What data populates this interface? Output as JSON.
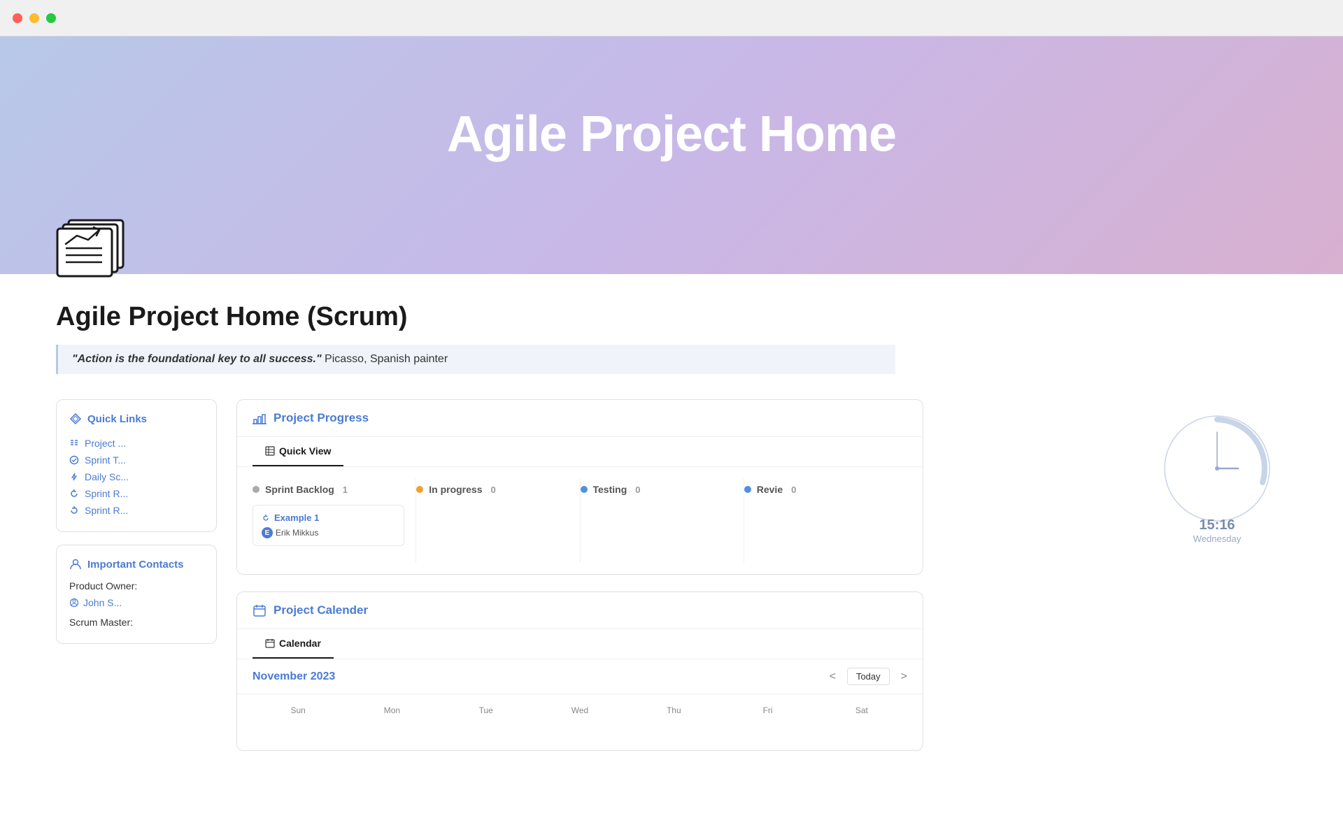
{
  "window": {
    "traffic_lights": [
      "red",
      "yellow",
      "green"
    ]
  },
  "hero": {
    "title": "Agile Project Home",
    "gradient_start": "#b8c4e0",
    "gradient_end": "#d4a8d8"
  },
  "page": {
    "title": "Agile Project Home (Scrum)",
    "quote_italic": "\"Action is the foundational key to all success.\"",
    "quote_attribution": " Picasso, Spanish painter"
  },
  "quick_links": {
    "title": "Quick Links",
    "items": [
      {
        "icon": "list-icon",
        "label": "Project ..."
      },
      {
        "icon": "check-icon",
        "label": "Sprint T..."
      },
      {
        "icon": "lightning-icon",
        "label": "Daily Sc..."
      },
      {
        "icon": "refresh-icon",
        "label": "Sprint R..."
      },
      {
        "icon": "refresh-icon",
        "label": "Sprint R..."
      }
    ]
  },
  "important_contacts": {
    "title": "Important Contacts",
    "product_owner_label": "Product Owner:",
    "product_owner_name": "John S...",
    "scrum_master_label": "Scrum Master:"
  },
  "project_progress": {
    "section_title": "Project Progress",
    "tabs": [
      {
        "label": "Quick View",
        "icon": "table-icon",
        "active": true
      }
    ],
    "columns": [
      {
        "id": "sprint-backlog",
        "label": "Sprint Backlog",
        "count": 1,
        "color": "#aaaaaa",
        "cards": [
          {
            "title": "Example 1",
            "assignee": "Erik Mikkus",
            "assignee_initial": "E"
          }
        ]
      },
      {
        "id": "in-progress",
        "label": "In progress",
        "count": 0,
        "color": "#f0a030",
        "cards": []
      },
      {
        "id": "testing",
        "label": "Testing",
        "count": 0,
        "color": "#5090e0",
        "cards": []
      },
      {
        "id": "review",
        "label": "Revie",
        "count": 0,
        "color": "#5090e0",
        "cards": []
      }
    ]
  },
  "project_calendar": {
    "section_title": "Project Calender",
    "tabs": [
      {
        "label": "Calendar",
        "icon": "calendar-icon",
        "active": true
      }
    ],
    "month": "November 2023",
    "today_label": "Today",
    "nav_prev": "<",
    "nav_next": ">"
  },
  "clock": {
    "time": "15:16",
    "day": "Wednesday",
    "color": "#b0bcd8"
  }
}
